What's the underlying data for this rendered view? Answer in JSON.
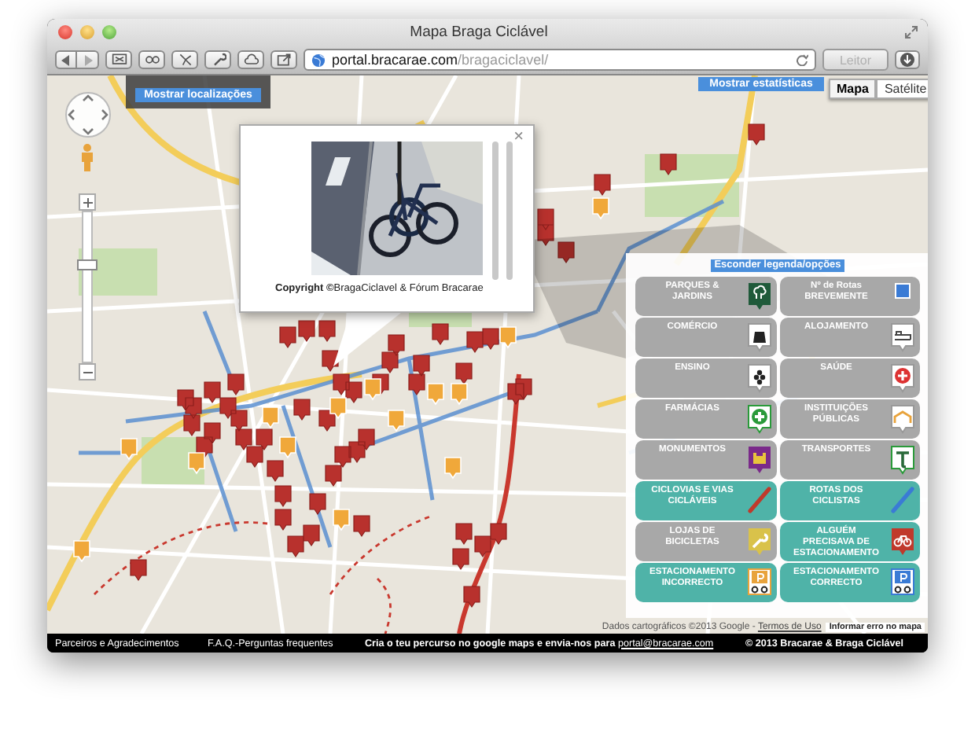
{
  "window": {
    "title": "Mapa Braga Ciclável"
  },
  "toolbar": {
    "address_host": "portal.bracarae.com",
    "address_path": "/bragaciclavel/",
    "reader_button": "Leitor",
    "reader_disabled": true
  },
  "map": {
    "locations_button": "Mostrar localizações",
    "stats_button": "Mostrar estatísticas",
    "map_types": [
      {
        "label": "Mapa",
        "selected": true
      },
      {
        "label": "Satélite",
        "selected": false
      }
    ],
    "zoom": {
      "level": 0.65
    },
    "popup": {
      "caption": "**Copyright ©**BragaCiclavel & Fórum Bracarae",
      "close": "×"
    },
    "legend": {
      "toggle": "Esconder legenda/opções",
      "items": [
        {
          "label": "PARQUES & JARDINS",
          "selected": false
        },
        {
          "label": "Nº de Rotas BREVEMENTE",
          "selected": false
        },
        {
          "label": "COMÉRCIO",
          "selected": false
        },
        {
          "label": "ALOJAMENTO",
          "selected": false
        },
        {
          "label": "ENSINO",
          "selected": false
        },
        {
          "label": "SAÚDE",
          "selected": false
        },
        {
          "label": "FARMÁCIAS",
          "selected": false
        },
        {
          "label": "INSTITUIÇÕES PÚBLICAS",
          "selected": false
        },
        {
          "label": "MONUMENTOS",
          "selected": false
        },
        {
          "label": "TRANSPORTES",
          "selected": false
        },
        {
          "label": "CICLOVIAS E VIAS CICLÁVEIS",
          "selected": true
        },
        {
          "label": "ROTAS DOS CICLISTAS",
          "selected": true
        },
        {
          "label": "LOJAS DE BICICLETAS",
          "selected": false
        },
        {
          "label": "ALGUÉM PRECISAVA DE ESTACIONAMENTO",
          "selected": true
        },
        {
          "label": "ESTACIONAMENTO INCORRECTO",
          "selected": true
        },
        {
          "label": "ESTACIONAMENTO CORRECTO",
          "selected": true
        }
      ]
    },
    "attribution": {
      "text": "Dados cartográficos ©2013 Google - ",
      "terms_link": "Termos de Uso",
      "report": "Informar erro no mapa"
    }
  },
  "footer": {
    "links": [
      "Parceiros e Agradecimentos",
      "F.A.Q.-Perguntas frequentes"
    ],
    "message": "Cria o teu percurso no google maps e envia-nos para ",
    "email": "portal@bracarae.com",
    "copyright": "© 2013 Bracarae & Braga Ciclável"
  }
}
